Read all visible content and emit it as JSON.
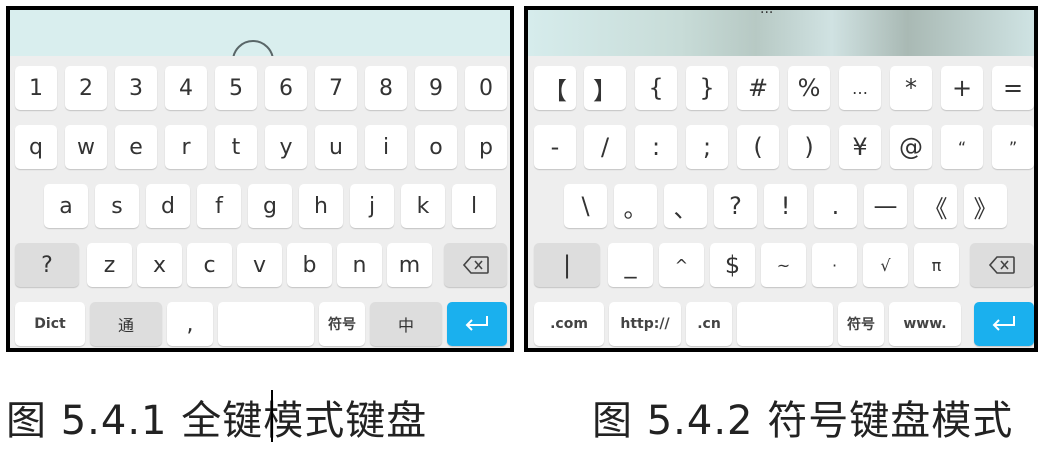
{
  "full_keyboard": {
    "row1": [
      "1",
      "2",
      "3",
      "4",
      "5",
      "6",
      "7",
      "8",
      "9",
      "0"
    ],
    "row2": [
      "q",
      "w",
      "e",
      "r",
      "t",
      "y",
      "u",
      "i",
      "o",
      "p"
    ],
    "row3": [
      "a",
      "s",
      "d",
      "f",
      "g",
      "h",
      "j",
      "k",
      "l"
    ],
    "row4": [
      "?",
      "z",
      "x",
      "c",
      "v",
      "b",
      "n",
      "m"
    ],
    "row5": {
      "dict": "Dict",
      "tong": "通",
      "comma": ",",
      "symbols": "符号",
      "chinese": "中"
    }
  },
  "symbol_keyboard": {
    "title": "...",
    "row1": [
      "【",
      "】",
      "{",
      "}",
      "#",
      "%",
      "…",
      "*",
      "+",
      "="
    ],
    "row2": [
      "-",
      "/",
      ":",
      ";",
      "(",
      ")",
      "¥",
      "@",
      "“",
      "”"
    ],
    "row3": [
      "\\",
      "。",
      "、",
      "?",
      "!",
      ".",
      "—",
      "《",
      "》"
    ],
    "row4": [
      "|",
      "_",
      "^",
      "$",
      "~",
      "·",
      "√",
      "π"
    ],
    "row5": {
      "com": ".com",
      "http": "http://",
      "cn": ".cn",
      "symbols": "符号",
      "www": "www."
    }
  },
  "captions": {
    "left": "图 5.4.1  全键模式键盘",
    "right": "图 5.4.2  符号键盘模式"
  },
  "colors": {
    "enter": "#1ab0ee",
    "gray_key": "#dddddd",
    "band": "#d9eeee"
  },
  "icons": {
    "delete": "backspace-icon",
    "enter": "enter-icon"
  }
}
